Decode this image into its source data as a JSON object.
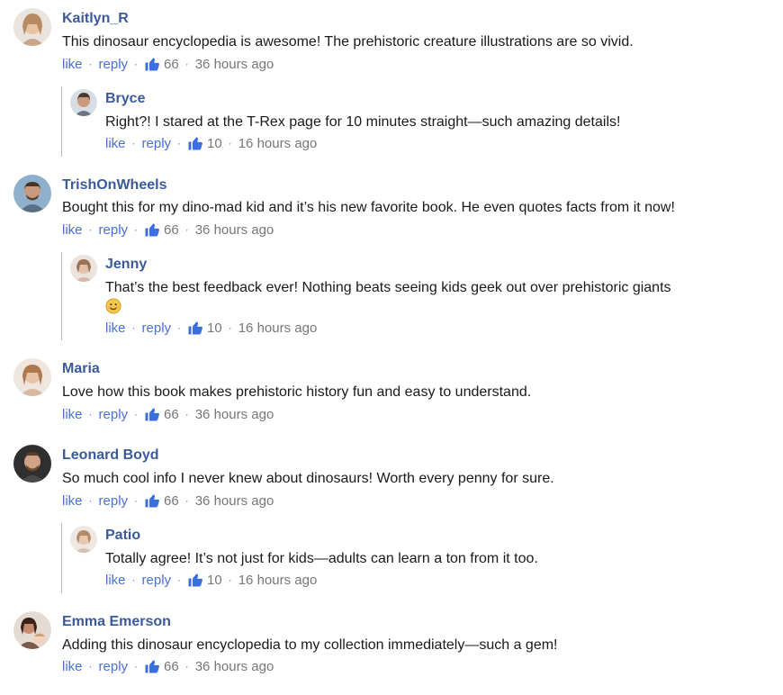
{
  "comments": [
    {
      "name": "Kaitlyn_R",
      "text": "This dinosaur encyclopedia is awesome! The prehistoric creature illustrations are so vivid.",
      "like": "like",
      "reply": "reply",
      "likes": "66",
      "time": "36 hours ago",
      "avatar_color": "#c9a58a"
    },
    {
      "name": "Bryce",
      "text": "Right?! I stared at the T-Rex page for 10 minutes straight—such amazing details!",
      "like": "like",
      "reply": "reply",
      "likes": "10",
      "time": "16 hours ago",
      "avatar_color": "#8a8f99"
    },
    {
      "name": "TrishOnWheels",
      "text": "Bought this for my dino-mad kid and it’s his new favorite book. He even quotes facts from it now!",
      "like": "like",
      "reply": "reply",
      "likes": "66",
      "time": "36 hours ago",
      "avatar_color": "#6d8fb0"
    },
    {
      "name": "Jenny",
      "text": "That’s the best feedback ever! Nothing beats seeing kids geek out over prehistoric giants",
      "emoji": "smiling-face-emoji",
      "like": "like",
      "reply": "reply",
      "likes": "10",
      "time": "16 hours ago",
      "avatar_color": "#d7b8a8"
    },
    {
      "name": "Maria",
      "text": "Love how this book makes prehistoric history fun and easy to understand.",
      "like": "like",
      "reply": "reply",
      "likes": "66",
      "time": "36 hours ago",
      "avatar_color": "#d8b8a0"
    },
    {
      "name": "Leonard Boyd",
      "text": "So much cool info I never knew about dinosaurs! Worth every penny for sure.",
      "like": "like",
      "reply": "reply",
      "likes": "66",
      "time": "36 hours ago",
      "avatar_color": "#3f3f3f"
    },
    {
      "name": "Patio",
      "text": "Totally agree! It’s not just for kids—adults can learn a ton from it too.",
      "like": "like",
      "reply": "reply",
      "likes": "10",
      "time": "16 hours ago",
      "avatar_color": "#d9c0ae"
    },
    {
      "name": "Emma Emerson",
      "text": "Adding this dinosaur encyclopedia to my collection immediately—such a gem!",
      "like": "like",
      "reply": "reply",
      "likes": "66",
      "time": "36 hours ago",
      "avatar_color": "#7a5a48"
    }
  ],
  "colors": {
    "name": "#3a5a99",
    "link": "#4a6fd8",
    "thumb": "#3b6fe0",
    "meta": "#777777"
  }
}
